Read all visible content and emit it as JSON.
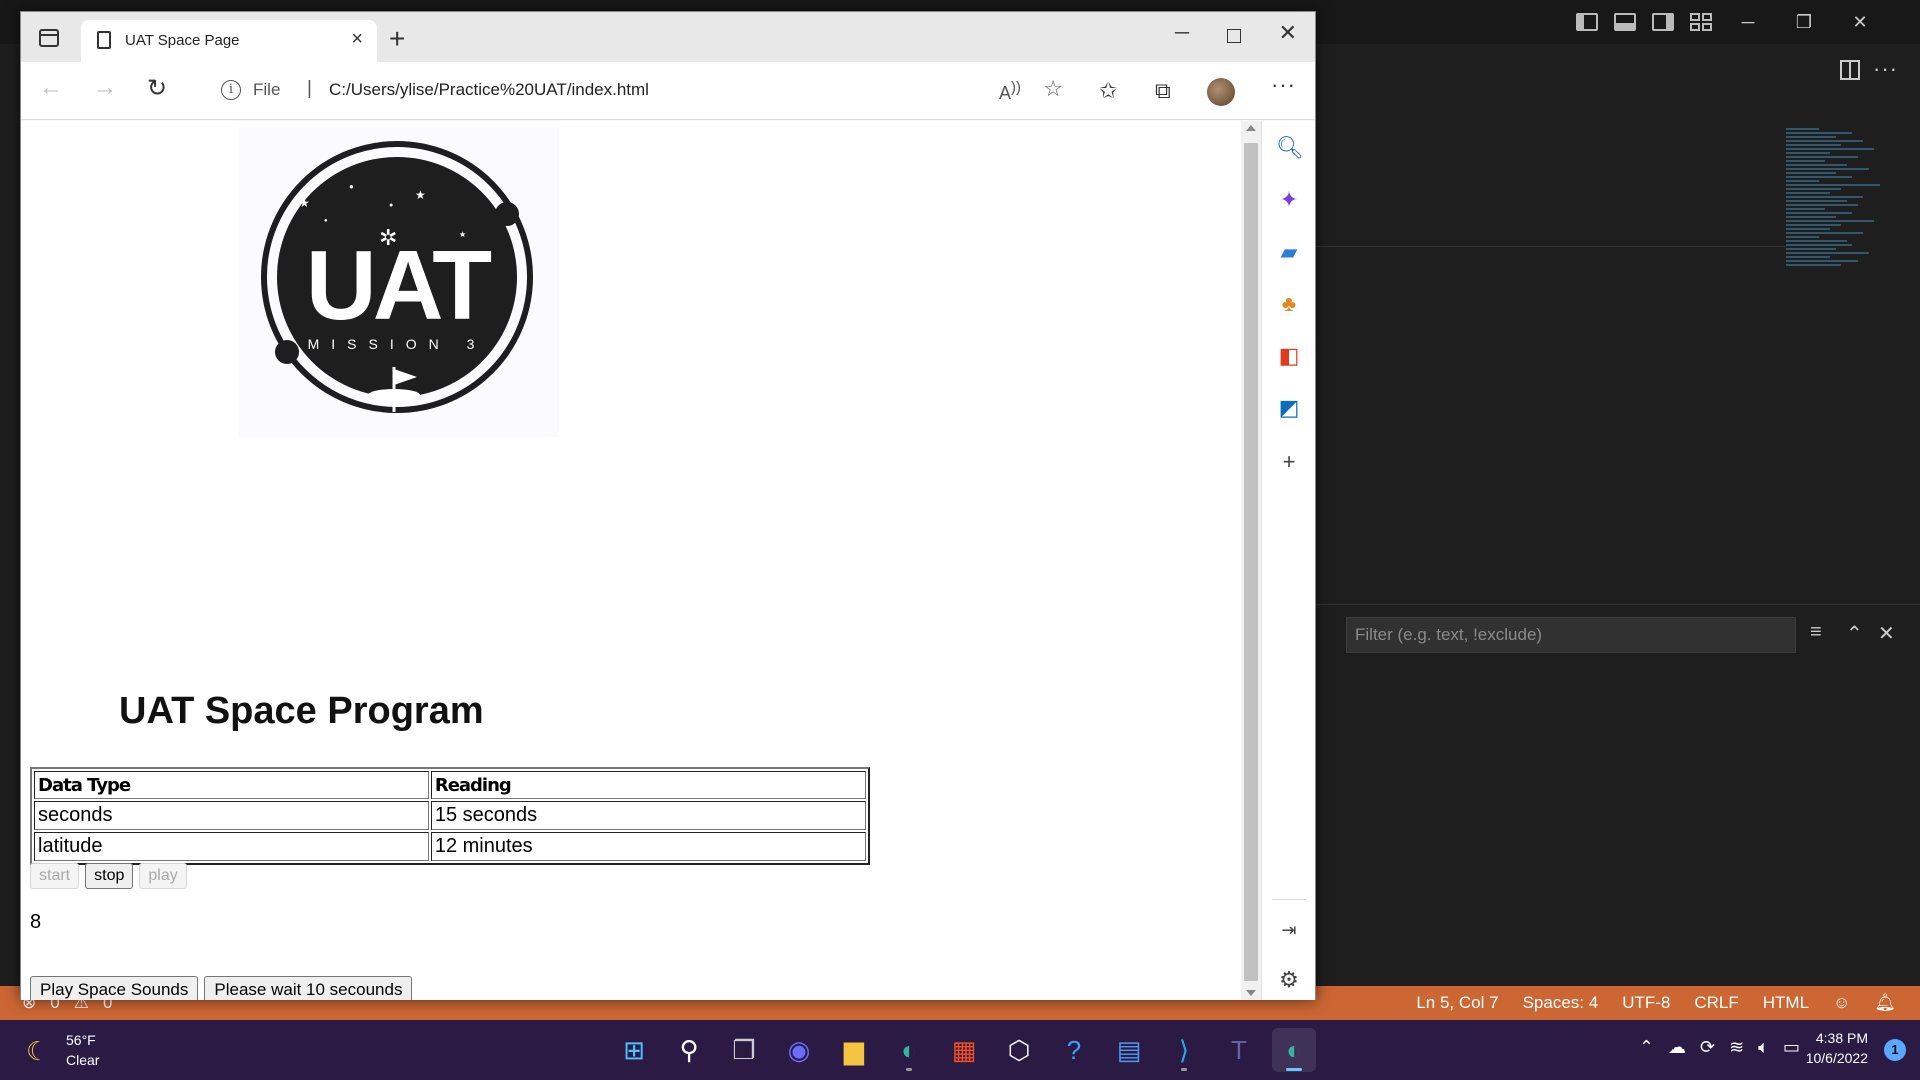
{
  "browser": {
    "tab_title": "UAT Space Page",
    "url_scheme": "File",
    "url_separator": "|",
    "url": "C:/Users/ylise/Practice%20UAT/index.html"
  },
  "page": {
    "logo_text": "UAT",
    "logo_subtitle": "MISSION 3",
    "heading": "UAT Space Program",
    "table": {
      "headers": [
        "Data Type",
        "Reading"
      ],
      "rows": [
        [
          "seconds",
          "15 seconds"
        ],
        [
          "latitude",
          "12 minutes"
        ]
      ]
    },
    "controls": {
      "start": "start",
      "stop": "stop",
      "play": "play"
    },
    "counter": "8",
    "sound_button": "Play Space Sounds",
    "wait_button": "Please wait 10 secounds"
  },
  "vscode": {
    "filter_placeholder": "Filter (e.g. text, !exclude)",
    "status": {
      "errors": "0",
      "warnings": "0",
      "position": "Ln 5, Col 7",
      "spaces": "Spaces: 4",
      "encoding": "UTF-8",
      "eol": "CRLF",
      "language": "HTML"
    }
  },
  "taskbar": {
    "temperature": "56°F",
    "weather": "Clear",
    "time": "4:38 PM",
    "date": "10/6/2022",
    "notifications": "1"
  },
  "colors": {
    "vscode_status": "#cc6633",
    "taskbar": "#2b1a44",
    "edge_accent": "#0078d4"
  }
}
